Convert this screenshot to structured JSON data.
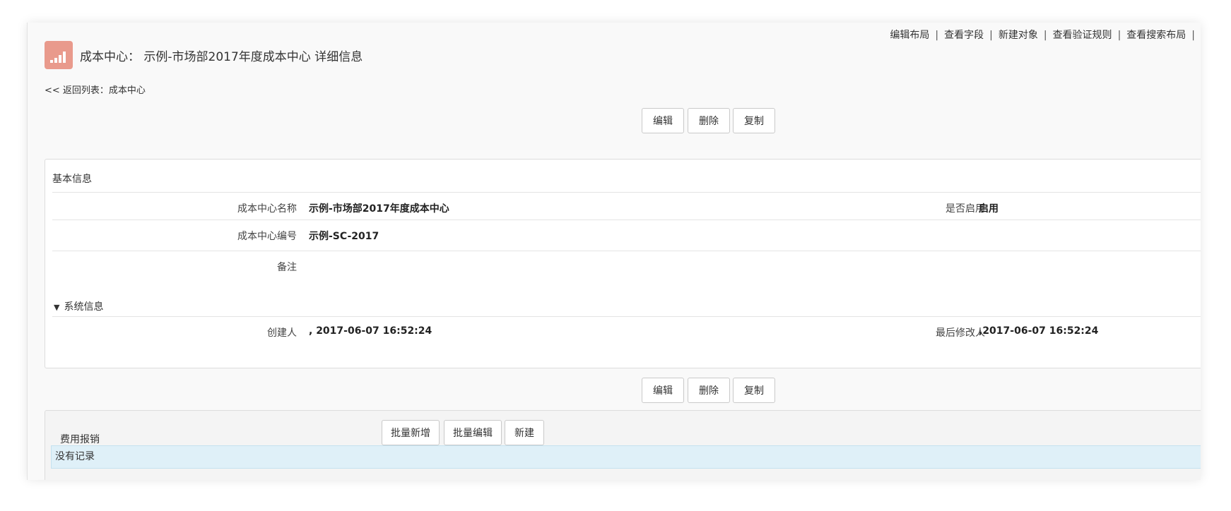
{
  "top_links": [
    "编辑布局",
    "查看字段",
    "新建对象",
    "查看验证规则",
    "查看搜索布局"
  ],
  "header": {
    "object_name": "成本中心：",
    "record_name": "示例-市场部2017年度成本中心",
    "suffix": "详细信息"
  },
  "back_link": "<< 返回列表：成本中心",
  "actions": {
    "edit": "编辑",
    "delete": "删除",
    "copy": "复制"
  },
  "basic_info": {
    "title": "基本信息",
    "fields": {
      "name_label": "成本中心名称",
      "name_value": "示例-市场部2017年度成本中心",
      "enabled_label": "是否启用",
      "enabled_value": "启用",
      "code_label": "成本中心编号",
      "code_value": "示例-SC-2017",
      "remark_label": "备注",
      "remark_value": ""
    }
  },
  "system_info": {
    "title": "系统信息",
    "creator_label": "创建人",
    "creator_value": ", 2017-06-07 16:52:24",
    "modifier_label": "最后修改人",
    "modifier_value": ",2017-06-07 16:52:24"
  },
  "related_list": {
    "title": "费用报销",
    "batch_add": "批量新增",
    "batch_edit": "批量编辑",
    "new": "新建",
    "empty_text": "没有记录"
  },
  "colors": {
    "icon_bg": "#e99a8c",
    "empty_row_bg": "#dff0f8"
  },
  "icons": {
    "app_icon": "signal-bars-icon",
    "toggle_icon": "triangle-down-icon"
  }
}
